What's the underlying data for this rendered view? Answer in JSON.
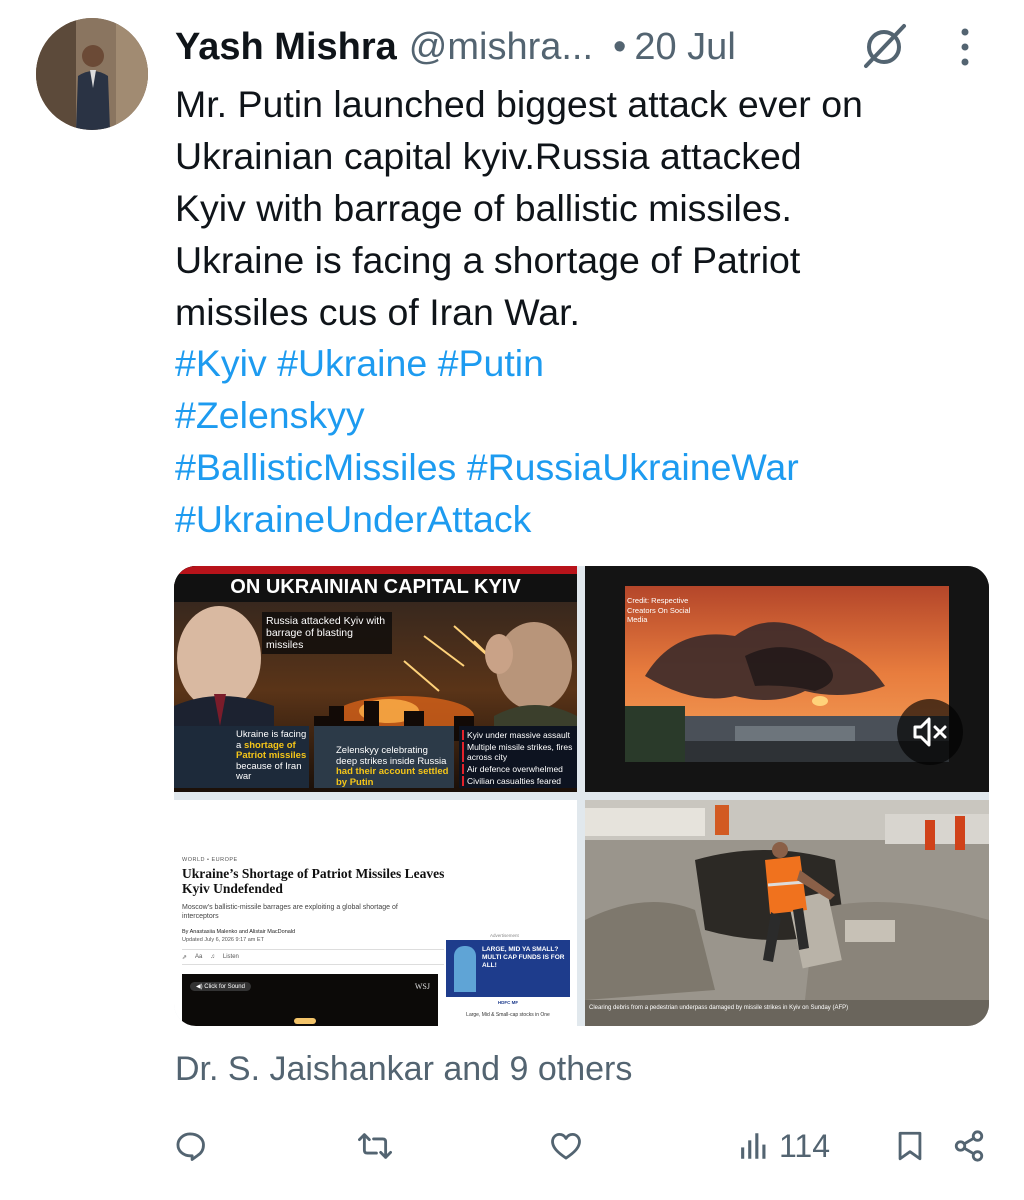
{
  "author": {
    "name": "Yash Mishra",
    "handle": "@mishra...",
    "separator": "•",
    "date": "20 Jul"
  },
  "tweet": {
    "lines": [
      "Mr. Putin launched biggest attack ever on",
      "Ukrainian capital kyiv.Russia attacked",
      "Kyiv with barrage of ballistic missiles.",
      "Ukraine is facing a shortage of Patriot",
      "missiles cus of Iran War."
    ],
    "hashtags": {
      "kyiv": "#Kyiv",
      "ukraine": "#Ukraine",
      "putin": "#Putin",
      "zelenskyy": "#Zelenskyy",
      "ballistic": "#BallisticMissiles",
      "russiaukraine": "#RussiaUkraineWar",
      "underattack": "#UkraineUnderAttack"
    }
  },
  "media": {
    "img1": {
      "headline": "ON UKRAINIAN CAPITAL KYIV",
      "box1": "Russia attacked Kyiv with barrage of blasting missiles",
      "box2_pre": "Ukraine is facing a ",
      "box2_hl": "shortage of Patriot missiles",
      "box2_post": " because of Iran war",
      "box3_pre": "Zelenskyy celebrating deep strikes inside Russia ",
      "box3_hl": "had their account settled by Putin",
      "bullets": [
        "Kyiv under massive assault",
        "Multiple missile strikes, fires across city",
        "Air defence overwhelmed",
        "Civilian casualties feared"
      ]
    },
    "img2": {
      "credit": "Credit: Respective Creators On Social Media",
      "mute_icon": "speaker-mute-icon"
    },
    "img3": {
      "section": "WORLD • EUROPE",
      "headline": "Ukraine’s Shortage of Patriot Missiles Leaves Kyiv Undefended",
      "subhead": "Moscow’s ballistic-missile barrages are exploiting a global shortage of interceptors",
      "byline": "By Anastasiia Malenko and Alistair MacDonald",
      "updated": "Updated July 6, 2026 9:17 am ET",
      "listen": "Listen",
      "click_sound": "Click for Sound",
      "wsj": "WSJ",
      "ad_label": "Advertisement",
      "ad_headline": "LARGE, MID YA SMALL? MULTI CAP FUNDS IS FOR ALL!",
      "ad_brand": "HDFC MF",
      "ad_footer": "Large, Mid & Small-cap stocks in One"
    },
    "img4": {
      "caption": "Clearing debris from a pedestrian underpass damaged by missile strikes in Kyiv on Sunday (AFP)"
    }
  },
  "likes": "Dr. S. Jaishankar and 9 others",
  "actions": {
    "views": "114"
  },
  "colors": {
    "link": "#1d9bf0",
    "muted": "#536471",
    "text": "#0f1419"
  }
}
